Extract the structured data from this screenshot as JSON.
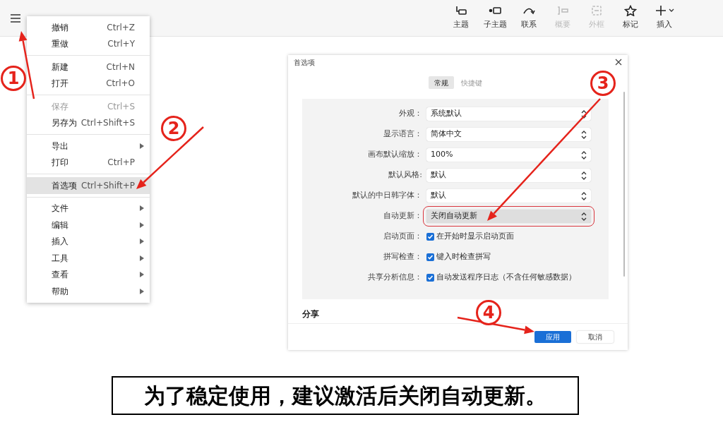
{
  "toolbar": [
    {
      "label": "主题",
      "disabled": false
    },
    {
      "label": "子主题",
      "disabled": false
    },
    {
      "label": "联系",
      "disabled": false
    },
    {
      "label": "概要",
      "disabled": true
    },
    {
      "label": "外框",
      "disabled": true
    },
    {
      "label": "标记",
      "disabled": false
    },
    {
      "label": "插入",
      "disabled": false
    }
  ],
  "menu": [
    [
      {
        "label": "撤销",
        "shortcut": "Ctrl+Z",
        "kind": "shortcut",
        "disabled": false,
        "selected": false
      },
      {
        "label": "重做",
        "shortcut": "Ctrl+Y",
        "kind": "shortcut",
        "disabled": false,
        "selected": false
      }
    ],
    [
      {
        "label": "新建",
        "shortcut": "Ctrl+N",
        "kind": "shortcut",
        "disabled": false,
        "selected": false
      },
      {
        "label": "打开",
        "shortcut": "Ctrl+O",
        "kind": "shortcut",
        "disabled": false,
        "selected": false
      }
    ],
    [
      {
        "label": "保存",
        "shortcut": "Ctrl+S",
        "kind": "shortcut",
        "disabled": true,
        "selected": false
      },
      {
        "label": "另存为",
        "shortcut": "Ctrl+Shift+S",
        "kind": "shortcut",
        "disabled": false,
        "selected": false
      }
    ],
    [
      {
        "label": "导出",
        "kind": "submenu",
        "disabled": false,
        "selected": false
      },
      {
        "label": "打印",
        "shortcut": "Ctrl+P",
        "kind": "shortcut",
        "disabled": false,
        "selected": false
      }
    ],
    [
      {
        "label": "首选项",
        "shortcut": "Ctrl+Shift+P",
        "kind": "shortcut",
        "disabled": false,
        "selected": true
      }
    ],
    [
      {
        "label": "文件",
        "kind": "submenu",
        "disabled": false,
        "selected": false
      },
      {
        "label": "编辑",
        "kind": "submenu",
        "disabled": false,
        "selected": false
      },
      {
        "label": "插入",
        "kind": "submenu",
        "disabled": false,
        "selected": false
      },
      {
        "label": "工具",
        "kind": "submenu",
        "disabled": false,
        "selected": false
      },
      {
        "label": "查看",
        "kind": "submenu",
        "disabled": false,
        "selected": false
      },
      {
        "label": "帮助",
        "kind": "submenu",
        "disabled": false,
        "selected": false
      }
    ]
  ],
  "dialog": {
    "title": "首选项",
    "tabs": [
      {
        "label": "常规",
        "selected": true
      },
      {
        "label": "快捷键",
        "selected": false
      }
    ],
    "rows": [
      {
        "kind": "select",
        "label": "外观：",
        "value": "系统默认",
        "annotated": false
      },
      {
        "kind": "select",
        "label": "显示语言：",
        "value": "简体中文",
        "annotated": false
      },
      {
        "kind": "select",
        "label": "画布默认缩放：",
        "value": "100%",
        "annotated": false
      },
      {
        "kind": "select",
        "label": "默认风格:",
        "value": "默认",
        "annotated": false
      },
      {
        "kind": "select",
        "label": "默认的中日韩字体：",
        "value": "默认",
        "annotated": false
      },
      {
        "kind": "select",
        "label": "自动更新：",
        "value": "关闭自动更新",
        "annotated": true
      },
      {
        "kind": "checkbox",
        "label": "启动页面：",
        "value": "在开始时显示启动页面",
        "checked": true
      },
      {
        "kind": "checkbox",
        "label": "拼写检查：",
        "value": "键入时检查拼写",
        "checked": true
      },
      {
        "kind": "checkbox",
        "label": "共享分析信息：",
        "value": "自动发送程序日志（不含任何敏感数据）",
        "checked": true
      }
    ],
    "section": "分享",
    "buttons": [
      {
        "label": "应用",
        "kind": "primary"
      },
      {
        "label": "取消",
        "kind": "secondary"
      }
    ]
  },
  "annotations": [
    {
      "label": "1"
    },
    {
      "label": "2"
    },
    {
      "label": "3"
    },
    {
      "label": "4"
    }
  ],
  "caption": "为了稳定使用，建议激活后关闭自动更新。"
}
